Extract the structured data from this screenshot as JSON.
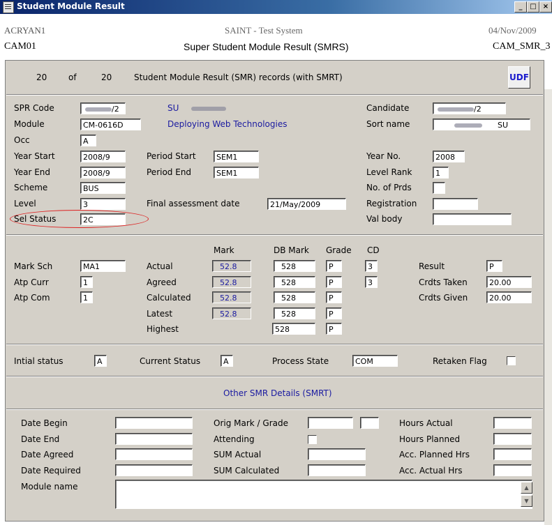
{
  "window": {
    "title": "Student Module Result",
    "buttons": [
      "_",
      "□",
      "×"
    ]
  },
  "header": {
    "user": "ACRYAN1",
    "system": "SAINT - Test System",
    "date": "04/Nov/2009",
    "code": "CAM01",
    "screen_title": "Super Student Module Result (SMRS)",
    "screen_code": "CAM_SMR_3"
  },
  "records": {
    "current": "20",
    "of_label": "of",
    "total": "20",
    "description": "Student Module Result (SMR) records (with SMRT)",
    "udf_label": "UDF"
  },
  "student": {
    "spr_code_label": "SPR Code",
    "spr_code_value": "/2",
    "spr_name_prefix": "SU",
    "module_label": "Module",
    "module_value": "CM-0616D",
    "module_name": "Deploying Web Technologies",
    "occ_label": "Occ",
    "occ_value": "A",
    "year_start_label": "Year Start",
    "year_start_value": "2008/9",
    "year_end_label": "Year End",
    "year_end_value": "2008/9",
    "scheme_label": "Scheme",
    "scheme_value": "BUS",
    "level_label": "Level",
    "level_value": "3",
    "sel_status_label": "Sel Status",
    "sel_status_value": "2C",
    "period_start_label": "Period Start",
    "period_start_value": "SEM1",
    "period_end_label": "Period End",
    "period_end_value": "SEM1",
    "final_assessment_label": "Final assessment date",
    "final_assessment_value": "21/May/2009",
    "candidate_label": "Candidate",
    "candidate_value": "/2",
    "sort_name_label": "Sort name",
    "sort_name_value": "SU",
    "year_no_label": "Year No.",
    "year_no_value": "2008",
    "level_rank_label": "Level Rank",
    "level_rank_value": "1",
    "no_prds_label": "No. of Prds",
    "no_prds_value": "",
    "registration_label": "Registration",
    "registration_value": "",
    "val_body_label": "Val body",
    "val_body_value": ""
  },
  "marks": {
    "col_mark": "Mark",
    "col_db_mark": "DB Mark",
    "col_grade": "Grade",
    "col_cd": "CD",
    "mark_sch_label": "Mark Sch",
    "mark_sch_value": "MA1",
    "atp_curr_label": "Atp Curr",
    "atp_curr_value": "1",
    "atp_com_label": "Atp Com",
    "atp_com_value": "1",
    "rows": [
      {
        "label": "Actual",
        "mark": "52.8",
        "db": "528",
        "grade": "P",
        "cd": "3"
      },
      {
        "label": "Agreed",
        "mark": "52.8",
        "db": "528",
        "grade": "P",
        "cd": "3"
      },
      {
        "label": "Calculated",
        "mark": "52.8",
        "db": "528",
        "grade": "P",
        "cd": ""
      },
      {
        "label": "Latest",
        "mark": "52.8",
        "db": "528",
        "grade": "P",
        "cd": ""
      },
      {
        "label": "Highest",
        "mark": "",
        "db": "528",
        "grade": "P",
        "cd": ""
      }
    ],
    "result_label": "Result",
    "result_value": "P",
    "crdts_taken_label": "Crdts Taken",
    "crdts_taken_value": "20.00",
    "crdts_given_label": "Crdts Given",
    "crdts_given_value": "20.00"
  },
  "status": {
    "initial_label": "Intial status",
    "initial_value": "A",
    "current_label": "Current Status",
    "current_value": "A",
    "process_label": "Process State",
    "process_value": "COM",
    "retaken_label": "Retaken Flag"
  },
  "smrt": {
    "heading": "Other SMR Details (SMRT)",
    "date_begin_label": "Date Begin",
    "date_end_label": "Date End",
    "date_agreed_label": "Date Agreed",
    "date_required_label": "Date Required",
    "module_name_label": "Module name",
    "orig_mark_label": "Orig Mark / Grade",
    "attending_label": "Attending",
    "sum_actual_label": "SUM Actual",
    "sum_calculated_label": "SUM Calculated",
    "hours_actual_label": "Hours Actual",
    "hours_planned_label": "Hours Planned",
    "acc_planned_label": "Acc. Planned Hrs",
    "acc_actual_label": "Acc. Actual Hrs"
  },
  "icons": {
    "scroll_up": "triangle-up",
    "scroll_down": "triangle-down"
  }
}
